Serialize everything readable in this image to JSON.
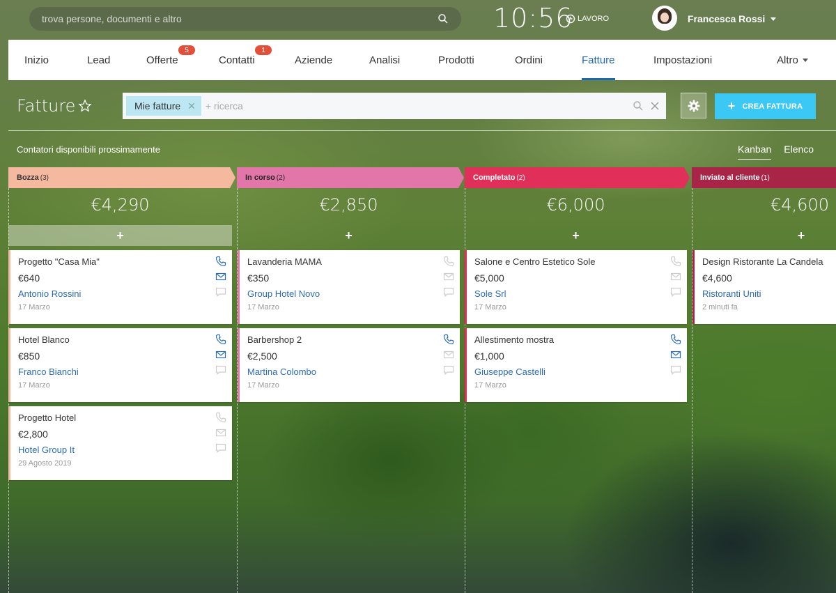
{
  "topbar": {
    "search_placeholder": "trova persone, documenti e altro",
    "clock": "10:56",
    "work_status": "LAVORO",
    "user_name": "Francesca Rossi"
  },
  "nav": {
    "items": [
      {
        "label": "Inizio"
      },
      {
        "label": "Lead"
      },
      {
        "label": "Offerte",
        "badge": "5"
      },
      {
        "label": "Contatti",
        "badge": "1"
      },
      {
        "label": "Aziende"
      },
      {
        "label": "Analisi"
      },
      {
        "label": "Prodotti"
      },
      {
        "label": "Ordini"
      },
      {
        "label": "Fatture",
        "active": true
      },
      {
        "label": "Impostazioni"
      },
      {
        "label": "Altro"
      }
    ]
  },
  "page": {
    "title": "Fatture",
    "filter_tag": "Mie fatture",
    "filter_placeholder": "+ ricerca",
    "create_button": "CREA FATTURA",
    "counters_note": "Contatori disponibili prossimamente",
    "view_kanban": "Kanban",
    "view_list": "Elenco"
  },
  "colors": {
    "stage_draft": "#f5b9a0",
    "stage_progress": "#e376a9",
    "stage_done": "#e0305a",
    "stage_sent": "#a82548",
    "link": "#2b6cb5",
    "accent": "#3bc8f5"
  },
  "stages": [
    {
      "name": "Bozza",
      "count": "(3)",
      "total": "€4,290",
      "cards": [
        {
          "title": "Progetto \"Casa Mia\"",
          "amount": "€640",
          "client": "Antonio Rossini",
          "date": "17 Marzo"
        },
        {
          "title": "Hotel Blanco",
          "amount": "€850",
          "client": "Franco Bianchi",
          "date": "17 Marzo"
        },
        {
          "title": "Progetto Hotel",
          "amount": "€2,800",
          "client": "Hotel Group It",
          "date": "29 Agosto 2019"
        }
      ]
    },
    {
      "name": "In corso",
      "count": "(2)",
      "total": "€2,850",
      "cards": [
        {
          "title": "Lavanderia MAMA",
          "amount": "€350",
          "client": "Group Hotel Novo",
          "date": "17 Marzo"
        },
        {
          "title": "Barbershop 2",
          "amount": "€2,500",
          "client": "Martina Colombo",
          "date": "17 Marzo"
        }
      ]
    },
    {
      "name": "Completato",
      "count": "(2)",
      "total": "€6,000",
      "cards": [
        {
          "title": "Salone e Centro Estetico Sole",
          "amount": "€5,000",
          "client": "Sole Srl",
          "date": "17 Marzo"
        },
        {
          "title": "Allestimento mostra",
          "amount": "€1,000",
          "client": "Giuseppe Castelli",
          "date": "17 Marzo"
        }
      ]
    },
    {
      "name": "Inviato al cliente",
      "count": "(1)",
      "total": "€4,600",
      "cards": [
        {
          "title": "Design Ristorante La Candela",
          "amount": "€4,600",
          "client": "Ristoranti Uniti",
          "date": "2 minuti fa"
        }
      ]
    }
  ]
}
